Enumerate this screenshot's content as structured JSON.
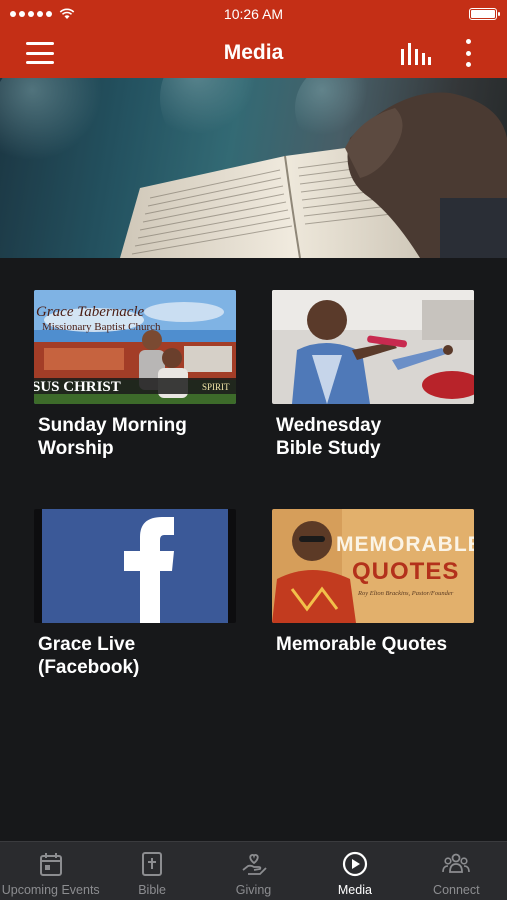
{
  "status_bar": {
    "time": "10:26 AM"
  },
  "header": {
    "title": "Media"
  },
  "tiles": [
    {
      "label": "Sunday Morning\nWorship",
      "thumb_text": {
        "line1": "Grace Tabernacle",
        "line2": "Missionary Baptist Church",
        "banner": "SUS CHRIST",
        "spirit": "SPIRIT"
      }
    },
    {
      "label": "Wednesday\nBible Study"
    },
    {
      "label": "Grace Live\n(Facebook)"
    },
    {
      "label": "Memorable Quotes",
      "thumb_text": {
        "line1": "MEMORABLE",
        "line2": "QUOTES",
        "line3": "Roy Elton Brackins, Pastor/Founder"
      }
    }
  ],
  "tab_bar": {
    "items": [
      {
        "label": "Upcoming Events",
        "icon": "calendar-icon"
      },
      {
        "label": "Bible",
        "icon": "bible-icon"
      },
      {
        "label": "Giving",
        "icon": "giving-hand-icon"
      },
      {
        "label": "Media",
        "icon": "play-circle-icon",
        "active": true
      },
      {
        "label": "Connect",
        "icon": "group-icon"
      }
    ]
  },
  "colors": {
    "brand": "#c42f16",
    "background": "#17181a",
    "tab_bar": "#2a2b2e",
    "facebook": "#3b5998"
  }
}
